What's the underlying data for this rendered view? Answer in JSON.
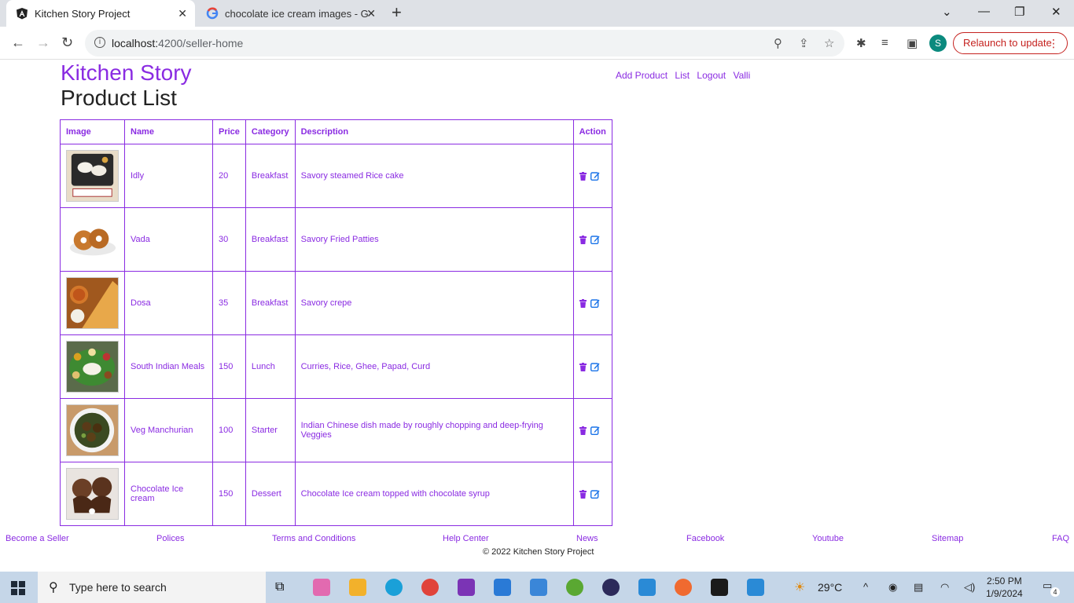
{
  "browser": {
    "tabs": [
      {
        "title": "Kitchen Story Project",
        "close": "✕"
      },
      {
        "title": "chocolate ice cream images - Go",
        "close": "✕"
      }
    ],
    "new_tab": "+",
    "window_controls": {
      "dropdown": "⌄",
      "minimize": "—",
      "restore": "❐",
      "close": "✕"
    },
    "url_host": "localhost:",
    "url_path": "4200/seller-home",
    "relaunch_label": "Relaunch to update",
    "profile_initial": "S"
  },
  "site": {
    "brand": "Kitchen Story",
    "page_title": "Product List",
    "nav": [
      "Add Product",
      "List",
      "Logout",
      "Valli"
    ]
  },
  "table": {
    "headers": [
      "Image",
      "Name",
      "Price",
      "Category",
      "Description",
      "Action"
    ],
    "rows": [
      {
        "name": "Idly",
        "price": "20",
        "category": "Breakfast",
        "description": "Savory steamed Rice cake"
      },
      {
        "name": "Vada",
        "price": "30",
        "category": "Breakfast",
        "description": "Savory Fried Patties"
      },
      {
        "name": "Dosa",
        "price": "35",
        "category": "Breakfast",
        "description": "Savory crepe"
      },
      {
        "name": "South Indian Meals",
        "price": "150",
        "category": "Lunch",
        "description": "Curries, Rice, Ghee, Papad, Curd"
      },
      {
        "name": "Veg Manchurian",
        "price": "100",
        "category": "Starter",
        "description": "Indian Chinese dish made by roughly chopping and deep-frying Veggies"
      },
      {
        "name": "Chocolate Ice cream",
        "price": "150",
        "category": "Dessert",
        "description": "Chocolate Ice cream topped with chocolate syrup"
      }
    ]
  },
  "footer": {
    "links": [
      "Become a Seller",
      "Polices",
      "Terms and Conditions",
      "Help Center",
      "News",
      "Facebook",
      "Youtube",
      "Sitemap",
      "FAQ"
    ],
    "copyright": "© 2022 Kitchen Story Project"
  },
  "taskbar": {
    "search_placeholder": "Type here to search",
    "weather": "29°C",
    "time": "2:50 PM",
    "date": "1/9/2024",
    "notification_count": "4"
  },
  "colors": {
    "accent": "#8a2be2",
    "edit": "#1a73e8"
  }
}
